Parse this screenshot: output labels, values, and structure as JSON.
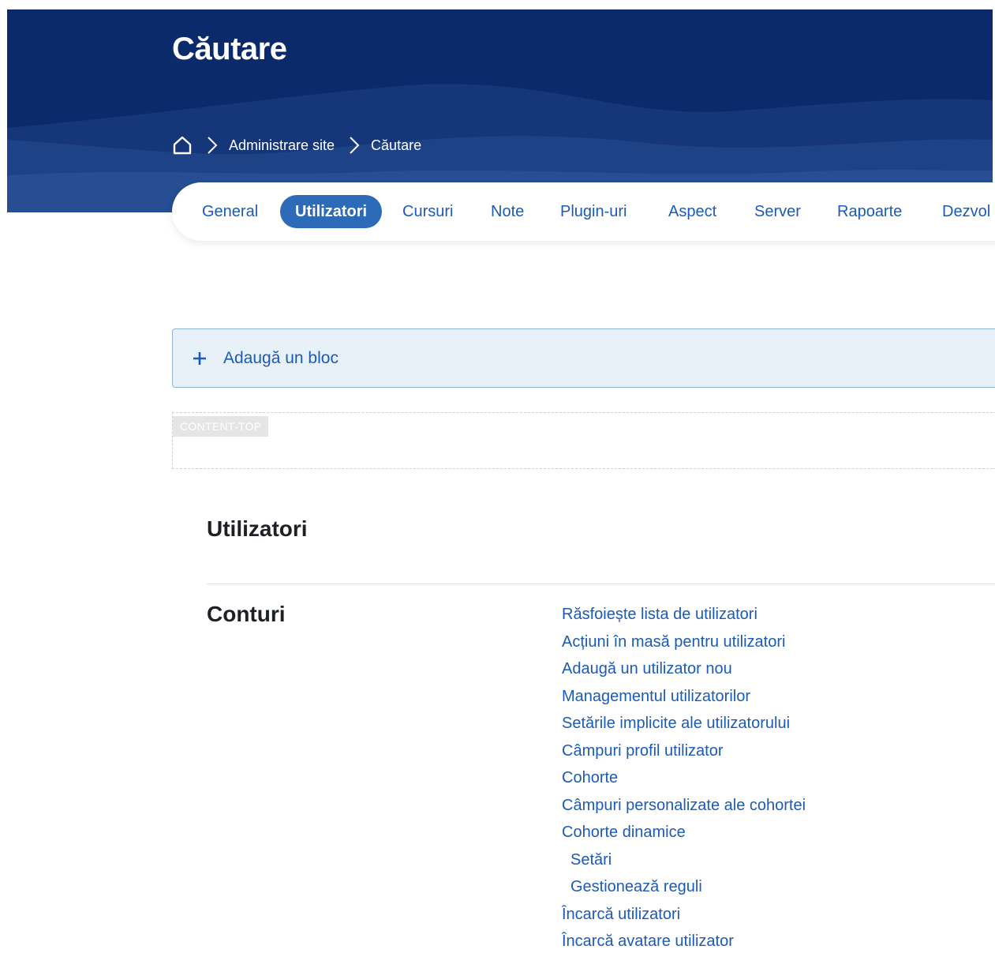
{
  "header": {
    "title": "Căutare",
    "breadcrumb": {
      "home_icon": "home-icon",
      "separator_icon": "chevron-right-icon",
      "items": [
        "Administrare site",
        "Căutare"
      ]
    }
  },
  "nav": {
    "tabs": [
      {
        "label": "General",
        "active": false
      },
      {
        "label": "Utilizatori",
        "active": true
      },
      {
        "label": "Cursuri",
        "active": false
      },
      {
        "label": "Note",
        "active": false
      },
      {
        "label": "Plugin-uri",
        "active": false
      },
      {
        "label": "Aspect",
        "active": false
      },
      {
        "label": "Server",
        "active": false
      },
      {
        "label": "Rapoarte",
        "active": false
      },
      {
        "label": "Dezvol",
        "active": false
      }
    ]
  },
  "add_block": {
    "icon": "plus-icon",
    "label": "Adaugă un bloc"
  },
  "region": {
    "label": "CONTENT-TOP"
  },
  "section": {
    "title": "Utilizatori",
    "group_title": "Conturi",
    "links": [
      {
        "label": "Răsfoiește lista de utilizatori",
        "indent": false
      },
      {
        "label": "Acțiuni în masă pentru utilizatori",
        "indent": false
      },
      {
        "label": "Adaugă un utilizator nou",
        "indent": false
      },
      {
        "label": "Managementul utilizatorilor",
        "indent": false
      },
      {
        "label": "Setările implicite ale utilizatorului",
        "indent": false
      },
      {
        "label": "Câmpuri profil utilizator",
        "indent": false
      },
      {
        "label": "Cohorte",
        "indent": false
      },
      {
        "label": "Câmpuri personalizate ale cohortei",
        "indent": false
      },
      {
        "label": "Cohorte dinamice",
        "indent": false
      },
      {
        "label": "Setări",
        "indent": true
      },
      {
        "label": "Gestionează reguli",
        "indent": true
      },
      {
        "label": "Încarcă utilizatori",
        "indent": false
      },
      {
        "label": "Încarcă avatare utilizator",
        "indent": false
      }
    ]
  },
  "colors": {
    "header_bg": "#0b2a6b",
    "link": "#1b5bb5",
    "active_tab": "#2d6ab8",
    "add_block_bg": "#e8f0f8"
  }
}
